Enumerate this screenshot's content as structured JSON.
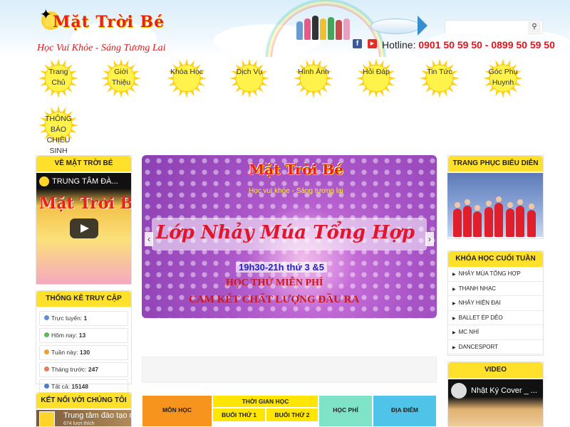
{
  "header": {
    "logo_text": "Mặt Trời Bé",
    "slogan": "Học Vui Khỏe - Sáng Tương Lai",
    "search": {
      "placeholder": "",
      "value": "",
      "button_icon": "search-icon"
    },
    "hotline_label": "Hotline:",
    "hotline_numbers": "0901 50 59 50 - 0899 50 59 50",
    "social": [
      {
        "name": "facebook",
        "glyph": "f"
      },
      {
        "name": "youtube",
        "glyph": "▶"
      }
    ]
  },
  "nav": {
    "items": [
      {
        "label": "Trang Chủ"
      },
      {
        "label": "Giới Thiệu"
      },
      {
        "label": "Khóa Học"
      },
      {
        "label": "Dịch Vụ"
      },
      {
        "label": "Hình Ảnh"
      },
      {
        "label": "Hỏi Đáp"
      },
      {
        "label": "Tin Tức"
      },
      {
        "label": "Góc Phụ Huynh"
      },
      {
        "label": "THÔNG BÁO CHIÊU SINH KHÓA HỌC"
      }
    ]
  },
  "left": {
    "about_title": "VỀ MẶT TRỜI BÉ",
    "about_video_title": "TRUNG TÂM ĐÀ...",
    "about_video_banner": "Mặt Trời Bé",
    "stats_title": "THỐNG KÊ TRUY CẬP",
    "stats": [
      {
        "label": "Trực tuyến:",
        "value": "1",
        "color": "#5b8fd6"
      },
      {
        "label": "Hôm nay:",
        "value": "13",
        "color": "#5cb85c"
      },
      {
        "label": "Tuần này:",
        "value": "130",
        "color": "#f0a030"
      },
      {
        "label": "Tháng trước:",
        "value": "247",
        "color": "#e87a5a"
      },
      {
        "label": "Tất cả:",
        "value": "15148",
        "color": "#4a7fc8"
      }
    ],
    "connect_title": "KẾT NỐI VỚI CHÚNG TÔI",
    "connect_page_name": "Trung tâm đào tạo n...",
    "connect_likes": "674 lượt thích"
  },
  "slider": {
    "logo_text": "Mặt Trời Bé",
    "slogan": "Học vui khỏe - Sáng tương lai",
    "title": "Lớp Nhảy Múa Tổng Hợp",
    "time": "19h30-21h thứ 3 &5",
    "free": "HỌC THỬ MIỄN PHÍ",
    "commit": "CAM KẾT CHẤT LƯỢNG ĐẦU RA",
    "prev": "‹",
    "next": "›"
  },
  "schedule": {
    "headers": {
      "subject": "MÔN HỌC",
      "time": "THỜI GIAN HỌC",
      "session1": "BUỔI THỨ 1",
      "session2": "BUỔI THỨ 2",
      "fee": "HỌC PHÍ",
      "location": "ĐỊA ĐIỂM"
    },
    "colors": {
      "subject": "#f7941d",
      "time": "#ffe600",
      "fee": "#7fe3c8",
      "location": "#4fc3e8"
    }
  },
  "right": {
    "costume_title": "TRANG PHỤC BIỂU DIỄN",
    "weekend_title": "KHÓA HỌC CUỐI TUẦN",
    "weekend_courses": [
      "NHẢY MÚA TỔNG HỢP",
      "THANH NHẠC",
      "NHẢY HIỆN ĐẠI",
      "BALLET ÉP DẺO",
      "MC NHÍ",
      "DANCESPORT"
    ],
    "video_title": "VIDEO",
    "video_caption": "Nhật Ký Cover _ ..."
  },
  "colors": {
    "accent_yellow": "#ffe12b",
    "brand_red": "#e3131b"
  }
}
